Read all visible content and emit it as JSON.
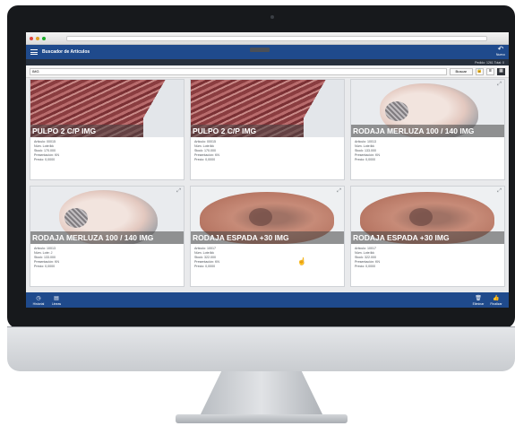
{
  "app": {
    "title": "Buscador de Articulos",
    "back_label": "Nuevo",
    "order_info": "Pedido: 1261 Total: 0"
  },
  "search": {
    "value": "IMG",
    "button_label": "Buscar",
    "icons": [
      "lock-icon",
      "list-view-icon",
      "grid-view-icon"
    ]
  },
  "products": [
    {
      "name": "PULPO 2 C/P IMG",
      "image": "octopus",
      "articulo": "Articulo: 00015",
      "lote": "Núm. Lote:lkk",
      "stock": "Stock: 170.000",
      "presentacion": "Presentación: KN",
      "precio": "Precio: 0,0000"
    },
    {
      "name": "PULPO 2 C/P IMG",
      "image": "octopus",
      "articulo": "Articulo: 00015",
      "lote": "Núm. Lote:lkk",
      "stock": "Stock: 170.000",
      "presentacion": "Presentación: KN",
      "precio": "Precio: 0,0000"
    },
    {
      "name": "RODAJA MERLUZA 100 / 140 IMG",
      "image": "hake",
      "articulo": "Articulo: 10013",
      "lote": "Núm. Lote:lkk",
      "stock": "Stock: 133.000",
      "presentacion": "Presentación: KN",
      "precio": "Precio: 0,0000"
    },
    {
      "name": "RODAJA MERLUZA 100 / 140 IMG",
      "image": "hake",
      "articulo": "Articulo: 10013",
      "lote": "Núm. Lote: J",
      "stock": "Stock: 133.000",
      "presentacion": "Presentación: KN",
      "precio": "Precio: 0,0000"
    },
    {
      "name": "RODAJA ESPADA +30 IMG",
      "image": "swordfish",
      "articulo": "Articulo: 10017",
      "lote": "Núm. Lote:lkk",
      "stock": "Stock: 322.000",
      "presentacion": "Presentación: KN",
      "precio": "Precio: 0,0000"
    },
    {
      "name": "RODAJA ESPADA +30 IMG",
      "image": "swordfish",
      "articulo": "Articulo: 10017",
      "lote": "Núm. Lote:lkk",
      "stock": "Stock: 322.000",
      "presentacion": "Presentación: KN",
      "precio": "Precio: 0,0000"
    }
  ],
  "bottom_bar": {
    "left": [
      {
        "label": "Historial",
        "icon": "clock-icon"
      },
      {
        "label": "Lineas",
        "icon": "table-icon"
      }
    ],
    "right": [
      {
        "label": "Eliminar",
        "icon": "trash-icon"
      },
      {
        "label": "Finalizar",
        "icon": "thumbs-up-icon"
      }
    ]
  },
  "colors": {
    "accent": "#1f4a8c",
    "subbar": "#27303d",
    "bezel": "#17191c"
  }
}
